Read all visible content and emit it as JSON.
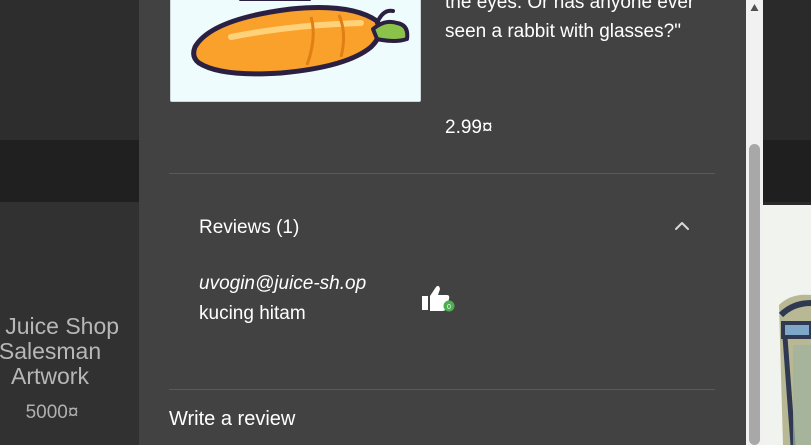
{
  "background": {
    "product_name": "st Juice Shop Salesman Artwork",
    "product_price": "5000¤"
  },
  "dialog": {
    "image_icon": "carrot-illustration",
    "description": "the eyes. Or has anyone ever seen a rabbit with glasses?\"",
    "price": "2.99¤",
    "reviews": {
      "title": "Reviews (1)",
      "expand_icon": "chevron-up-icon",
      "items": [
        {
          "author": "uvogin@juice-sh.op",
          "text": "kucing hitam",
          "like_icon": "thumbs-up-icon"
        }
      ]
    },
    "write_review_label": "Write a review"
  },
  "scrollbar": {
    "up_icon": "triangle-up-icon"
  },
  "colors": {
    "dialog_bg": "#424242",
    "accent_green": "#4caf50"
  }
}
